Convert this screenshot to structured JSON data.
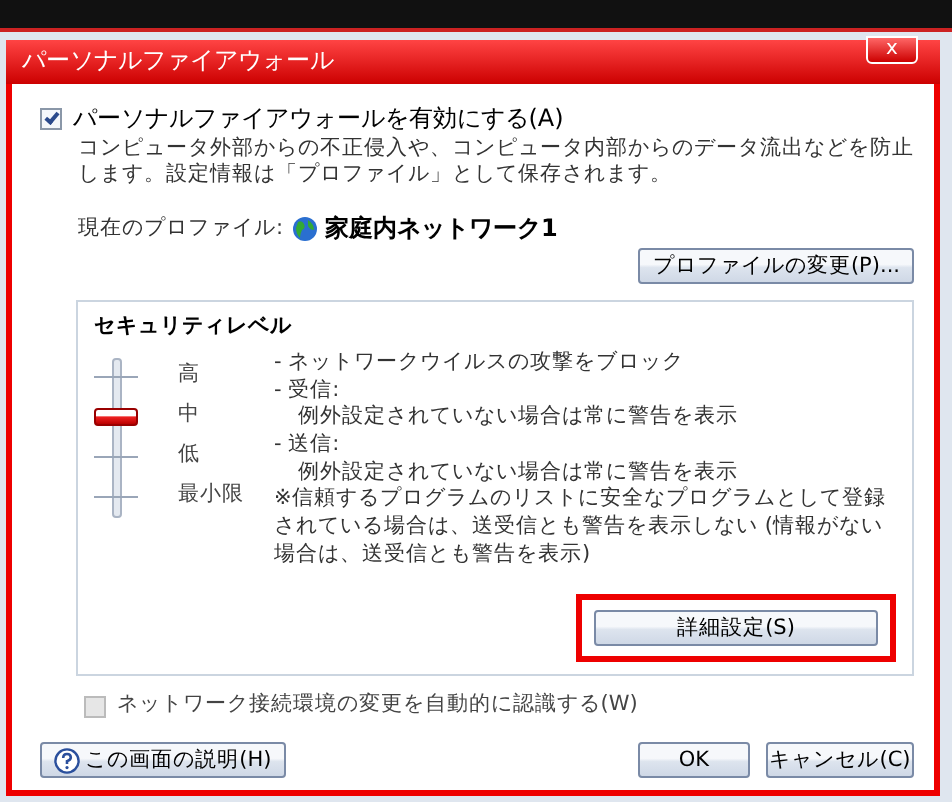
{
  "window": {
    "title": "パーソナルファイアウォール",
    "close": "x"
  },
  "enable": {
    "label": "パーソナルファイアウォールを有効にする(A)",
    "checked": true
  },
  "description": "コンピュータ外部からの不正侵入や、コンピュータ内部からのデータ流出などを防止します。設定情報は「プロファイル」として保存されます。",
  "profile": {
    "label": "現在のプロファイル:",
    "name": "家庭内ネットワーク1",
    "button": "プロファイルの変更(P)..."
  },
  "security": {
    "title": "セキュリティレベル",
    "levels": [
      {
        "label": "高",
        "selected": false
      },
      {
        "label": "中",
        "selected": true
      },
      {
        "label": "低",
        "selected": false
      },
      {
        "label": "最小限",
        "selected": false
      }
    ],
    "details": [
      "- ネットワークウイルスの攻撃をブロック",
      "- 受信:",
      "例外設定されていない場合は常に警告を表示",
      "- 送信:",
      "例外設定されていない場合は常に警告を表示",
      "※信頼するプログラムのリストに安全なプログラムとして登録されている場合は、送受信とも警告を表示しない (情報がない場合は、送受信とも警告を表示)"
    ],
    "button": {
      "label": "詳細設定(S)",
      "highlighted": true
    }
  },
  "auto_detect": {
    "label": "ネットワーク接続環境の変更を自動的に認識する(W)",
    "checked": false,
    "disabled": true
  },
  "buttons": [
    {
      "kind": "help",
      "label": "この画面の説明(H)"
    },
    {
      "kind": "ok",
      "label": "OK"
    },
    {
      "kind": "cancel",
      "label": "キャンセル(C)"
    }
  ]
}
